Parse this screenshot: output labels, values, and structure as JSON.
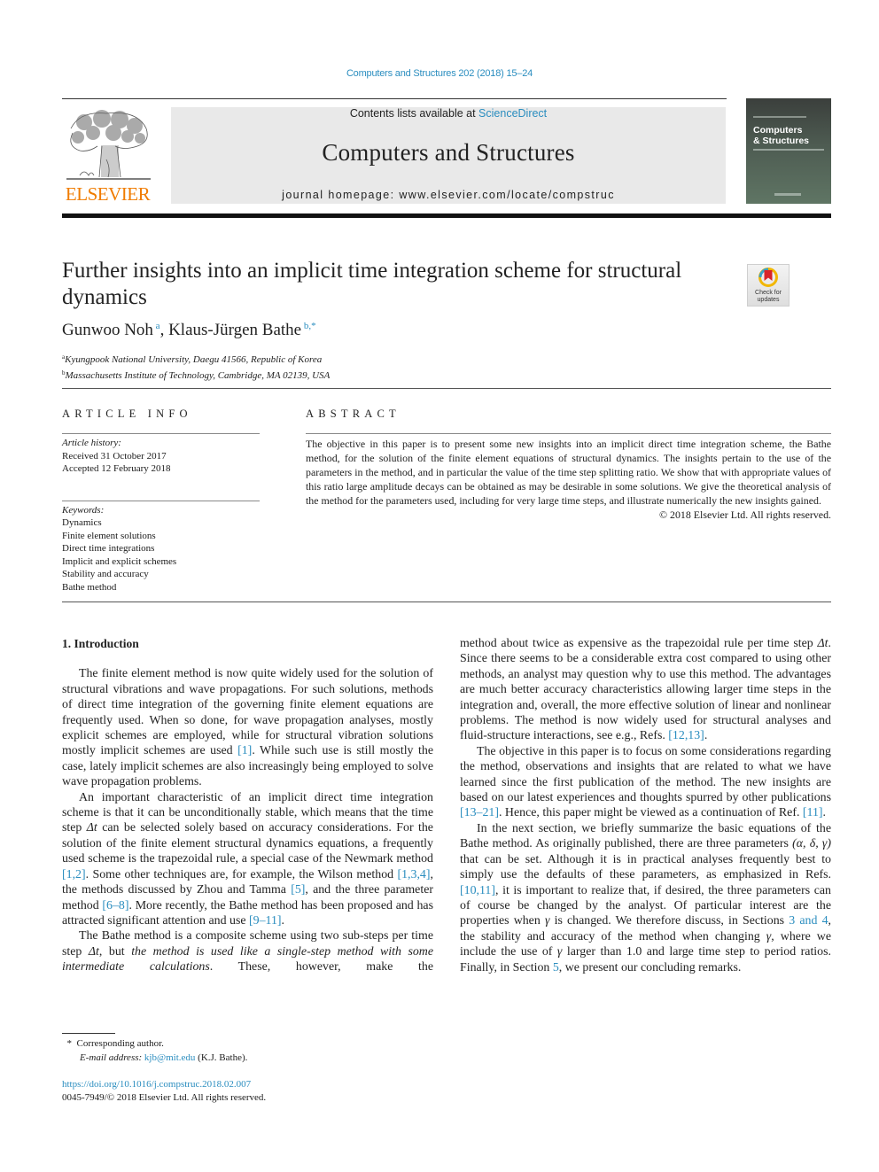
{
  "running_head": "Computers and Structures 202 (2018) 15–24",
  "masthead": {
    "publisher_logo_text": "ELSEVIER",
    "contents_prefix": "Contents lists available at ",
    "contents_link": "ScienceDirect",
    "journal_title": "Computers and Structures",
    "homepage": "journal homepage: www.elsevier.com/locate/compstruc",
    "cover_title_line1": "Computers",
    "cover_title_line2": "& Structures"
  },
  "article": {
    "title": "Further insights into an implicit time integration scheme for structural dynamics",
    "crossmark_line1": "Check for",
    "crossmark_line2": "updates",
    "authors": [
      {
        "name": "Gunwoo Noh",
        "sup": "a"
      },
      {
        "name": "Klaus-Jürgen Bathe",
        "sup": "b,*"
      }
    ],
    "author_separator": ", ",
    "affiliations": [
      {
        "sup": "a",
        "text": "Kyungpook National University, Daegu 41566, Republic of Korea"
      },
      {
        "sup": "b",
        "text": "Massachusetts Institute of Technology, Cambridge, MA 02139, USA"
      }
    ]
  },
  "article_info": {
    "heading": "ARTICLE INFO",
    "history_label": "Article history:",
    "received": "Received 31 October 2017",
    "accepted": "Accepted 12 February 2018",
    "keywords_label": "Keywords:",
    "keywords": [
      "Dynamics",
      "Finite element solutions",
      "Direct time integrations",
      "Implicit and explicit schemes",
      "Stability and accuracy",
      "Bathe method"
    ]
  },
  "abstract": {
    "heading": "ABSTRACT",
    "text": "The objective in this paper is to present some new insights into an implicit direct time integration scheme, the Bathe method, for the solution of the finite element equations of structural dynamics. The insights pertain to the use of the parameters in the method, and in particular the value of the time step splitting ratio. We show that with appropriate values of this ratio large amplitude decays can be obtained as may be desirable in some solutions. We give the theoretical analysis of the method for the parameters used, including for very large time steps, and illustrate numerically the new insights gained.",
    "copyright": "© 2018 Elsevier Ltd. All rights reserved."
  },
  "body": {
    "section1_heading": "1. Introduction",
    "p1": {
      "a": "The finite element method is now quite widely used for the solution of structural vibrations and wave propagations. For such solutions, methods of direct time integration of the governing finite element equations are frequently used. When so done, for wave propagation analyses, mostly explicit schemes are employed, while for structural vibration solutions mostly implicit schemes are used ",
      "ref1": "[1]",
      "b": ". While such use is still mostly the case, lately implicit schemes are also increasingly being employed to solve wave propagation problems."
    },
    "p2": {
      "a": "An important characteristic of an implicit direct time integration scheme is that it can be unconditionally stable, which means that the time step ",
      "dt": "Δt",
      "b": " can be selected solely based on accuracy considerations. For the solution of the finite element structural dynamics equations, a frequently used scheme is the trapezoidal rule, a special case of the Newmark method ",
      "ref1": "[1,2]",
      "c": ". Some other techniques are, for example, the Wilson method ",
      "ref2": "[1,3,4]",
      "d": ", the methods discussed by Zhou and Tamma ",
      "ref3": "[5]",
      "e": ", and the three parameter method ",
      "ref4": "[6–8]",
      "f": ". More recently, the Bathe method has been proposed and has attracted significant attention and use ",
      "ref5": "[9–11]",
      "g": "."
    },
    "p3": {
      "a": "The Bathe method is a composite scheme using two sub-steps per time step ",
      "dt": "Δt",
      "b": ", but ",
      "italic": "the method is used like a single-step method with some intermediate calculations",
      "c": ". These, however, make the method about twice as expensive as the trapezoidal rule per time step ",
      "dt2": "Δt",
      "d": ". Since there seems to be a considerable extra cost compared to using other methods, an analyst may question why to use this method. The advantages are much better accuracy characteristics allowing larger time steps in the integration and, overall, the more effective solution of linear and nonlinear problems. The method is now widely used for structural analyses and fluid-structure interactions, see e.g., Refs. ",
      "ref1": "[12,13]",
      "e": "."
    },
    "p4": {
      "a": "The objective in this paper is to focus on some considerations regarding the method, observations and insights that are related to what we have learned since the first publication of the method. The new insights are based on our latest experiences and thoughts spurred by other publications ",
      "ref1": "[13–21]",
      "b": ". Hence, this paper might be viewed as a continuation of Ref. ",
      "ref2": "[11]",
      "c": "."
    },
    "p5": {
      "a": "In the next section, we briefly summarize the basic equations of the Bathe method. As originally published, there are three parameters ",
      "params": "(α, δ, γ)",
      "b": " that can be set. Although it is in practical analyses frequently best to simply use the defaults of these parameters, as emphasized in Refs. ",
      "ref1": "[10,11]",
      "c": ", it is important to realize that, if desired, the three parameters can of course be changed by the analyst. Of particular interest are the properties when ",
      "gamma": "γ",
      "d": " is changed. We therefore discuss, in Sections ",
      "ref2": "3 and 4",
      "e": ", the stability and accuracy of the method when changing ",
      "f": ", where we include the use of ",
      "g": " larger than 1.0 and large time step to period ratios. Finally, in Section ",
      "ref3": "5",
      "h": ", we present our concluding remarks."
    }
  },
  "footnotes": {
    "star": "*",
    "corresponding": "Corresponding author.",
    "email_label": "E-mail address:",
    "email": "kjb@mit.edu",
    "email_suffix": " (K.J. Bathe)."
  },
  "doi": {
    "url": "https://doi.org/10.1016/j.compstruc.2018.02.007",
    "issn_line": "0045-7949/© 2018 Elsevier Ltd. All rights reserved."
  },
  "colors": {
    "link": "#2a8dbf",
    "elsevier_orange": "#f07c00",
    "masthead_bg": "#e9e9e9"
  }
}
